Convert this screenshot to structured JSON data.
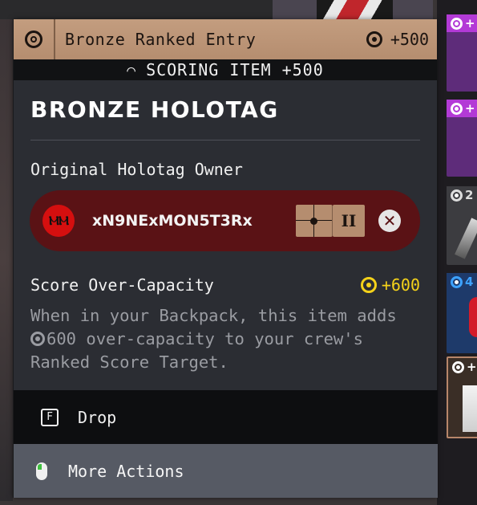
{
  "header": {
    "title": "Bronze Ranked Entry",
    "value": "+500",
    "icon": "target-icon"
  },
  "scoring_banner": {
    "text": "SCORING ITEM +500",
    "icon": "arc-icon"
  },
  "item": {
    "name": "BRONZE HOLOTAG"
  },
  "owner": {
    "section_label": "Original Holotag Owner",
    "avatar_text": "ⲘⲘ",
    "name": "xN9NExMON5T3Rx",
    "rank_symbol": "II",
    "platform_icon": "xbox-icon",
    "platform_glyph": "✕"
  },
  "score": {
    "label": "Score Over-Capacity",
    "value": "+600",
    "desc_prefix": "When in your Backpack, this item adds ",
    "desc_amount": "600",
    "desc_suffix": " over-capacity to your crew's Ranked Score Target."
  },
  "actions": {
    "drop_key": "F",
    "drop_label": "Drop",
    "more_label": "More Actions"
  },
  "side_tiles": [
    {
      "value": "+"
    },
    {
      "value": "+"
    },
    {
      "value": "2"
    },
    {
      "value": "4"
    },
    {
      "value": "+"
    }
  ],
  "colors": {
    "bronze": "#b58d6f",
    "owner_bg": "#5a1215",
    "score_accent": "#f4d21a",
    "panel_bg": "#2b2d33"
  }
}
